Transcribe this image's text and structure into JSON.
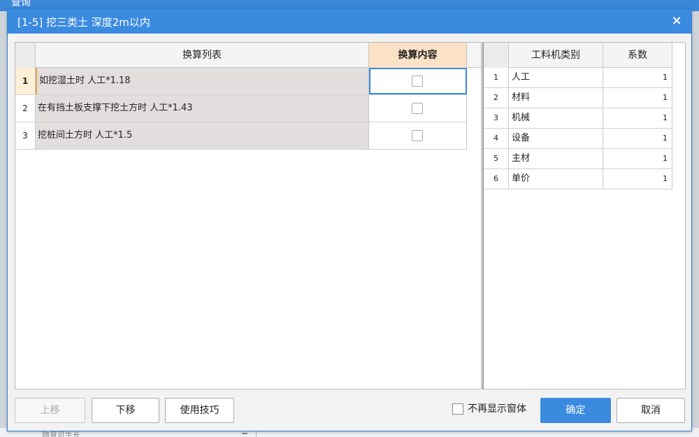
{
  "background": {
    "app_title": "查询",
    "bottom_text": "随意可生长"
  },
  "dialog": {
    "title": "[1-5] 挖三类土 深度2m以内",
    "close_glyph": "×"
  },
  "conversion": {
    "headers": {
      "list": "换算列表",
      "content": "换算内容"
    },
    "rows": [
      {
        "num": "1",
        "text": "如挖湿土时 人工*1.18",
        "checked": false
      },
      {
        "num": "2",
        "text": "在有挡土板支撑下挖土方时 人工*1.43",
        "checked": false
      },
      {
        "num": "3",
        "text": "挖桩间土方时 人工*1.5",
        "checked": false
      }
    ]
  },
  "coefficients": {
    "headers": {
      "type": "工料机类别",
      "coef": "系数"
    },
    "rows": [
      {
        "num": "1",
        "type": "人工",
        "coef": "1"
      },
      {
        "num": "2",
        "type": "材料",
        "coef": "1"
      },
      {
        "num": "3",
        "type": "机械",
        "coef": "1"
      },
      {
        "num": "4",
        "type": "设备",
        "coef": "1"
      },
      {
        "num": "5",
        "type": "主材",
        "coef": "1"
      },
      {
        "num": "6",
        "type": "单价",
        "coef": "1"
      }
    ]
  },
  "footer": {
    "move_up": "上移",
    "move_down": "下移",
    "tips": "使用技巧",
    "no_show_again": "不再显示窗体",
    "ok": "确定",
    "cancel": "取消"
  },
  "colors": {
    "accent": "#3a8ae0",
    "header_highlight": "#fbe2c6",
    "row_text_bg": "#e3dede"
  }
}
